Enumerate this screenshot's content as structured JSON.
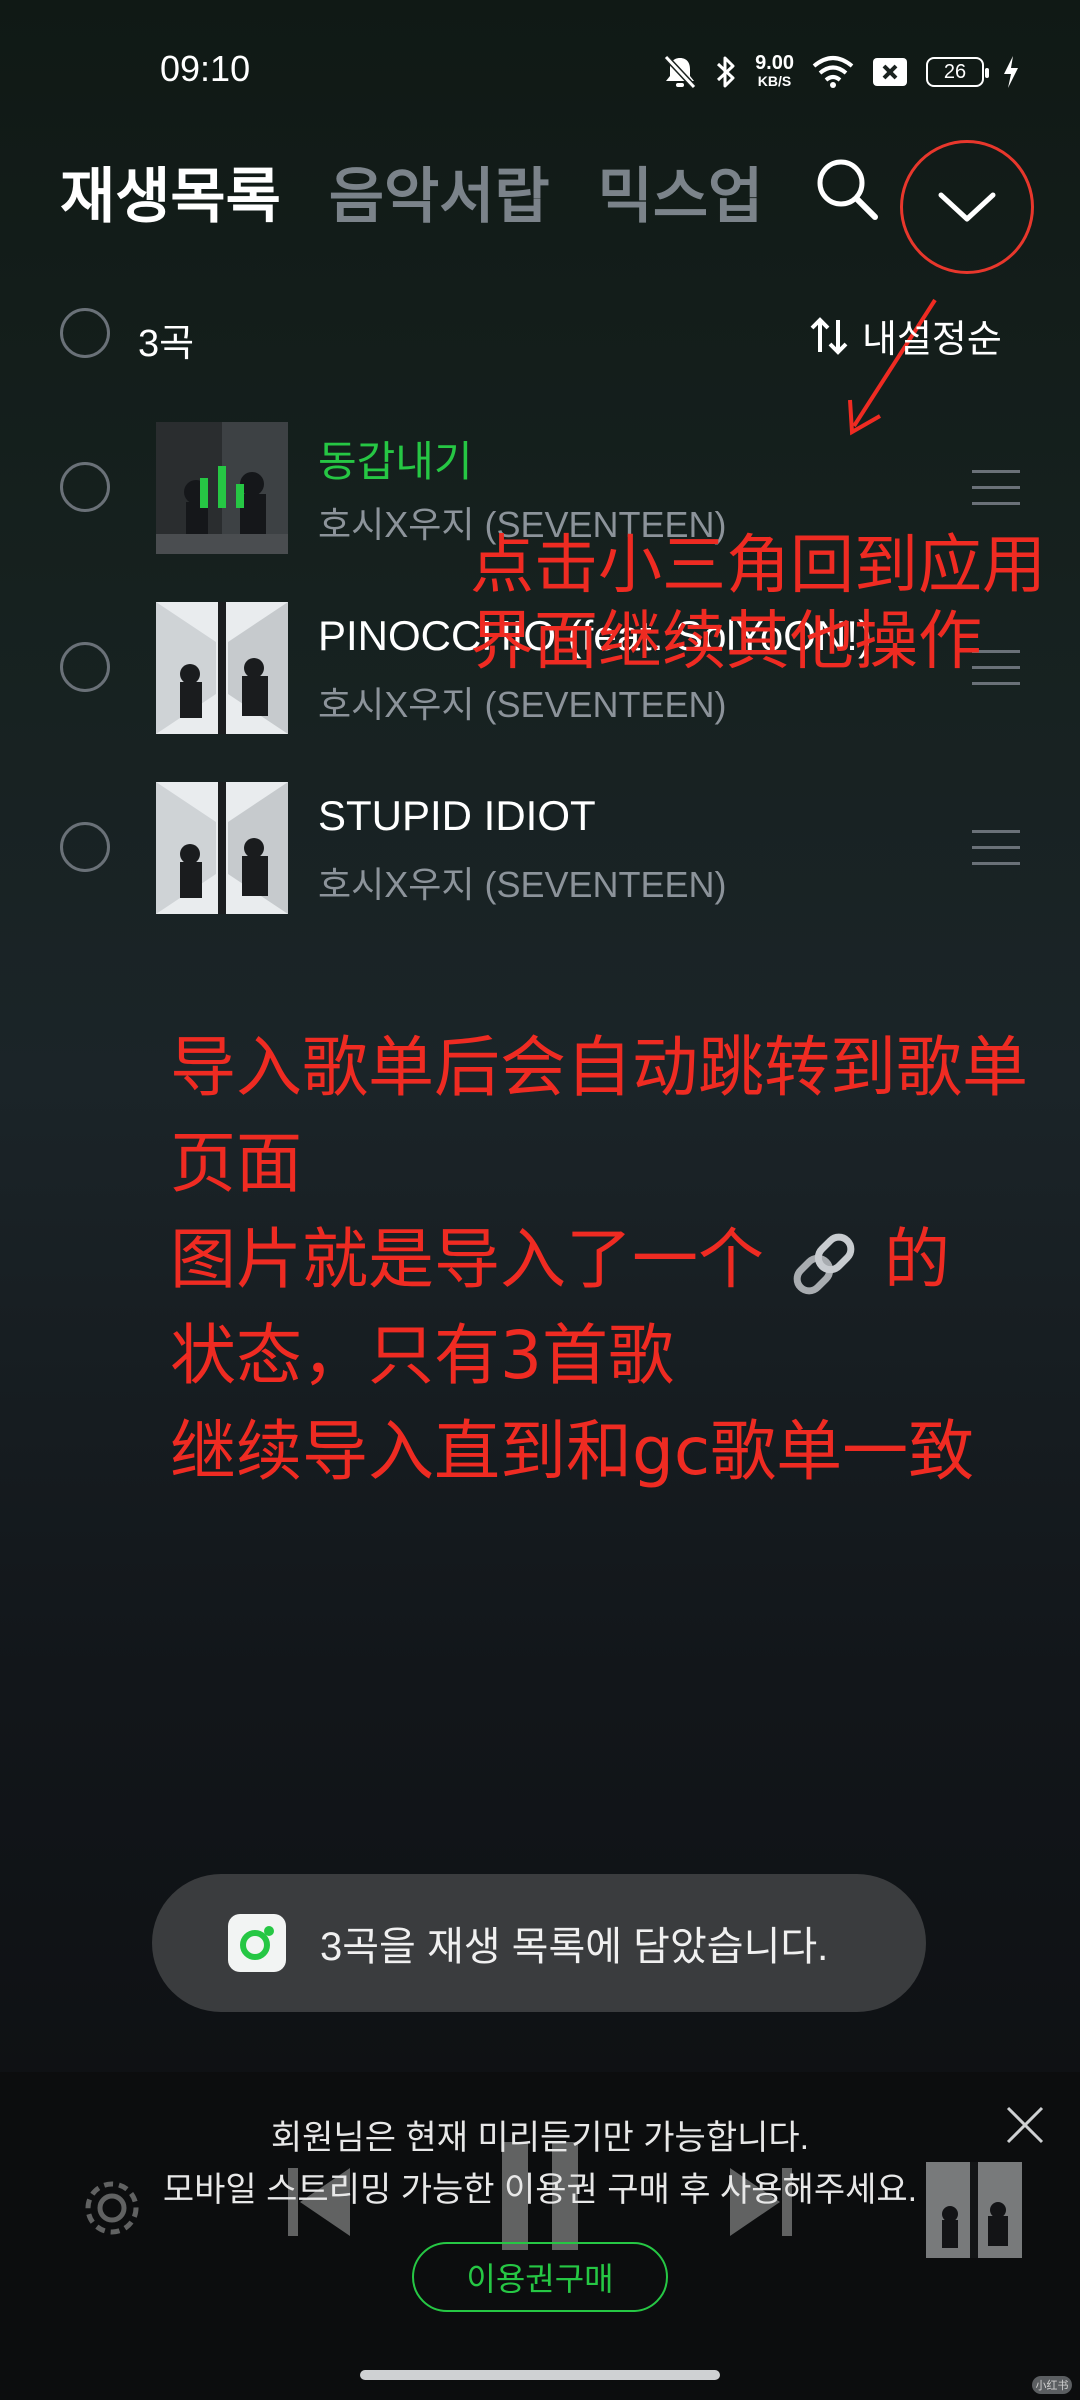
{
  "status_bar": {
    "time": "09:10",
    "net_speed_value": "9.00",
    "net_speed_unit": "KB/S",
    "battery": "26",
    "icons": [
      "mute-icon",
      "bluetooth-icon",
      "wifi-icon",
      "x-box-icon",
      "battery-icon",
      "charging-icon"
    ]
  },
  "header": {
    "tabs": [
      {
        "label": "재생목록",
        "active": true
      },
      {
        "label": "음악서랍",
        "active": false
      },
      {
        "label": "믹스업",
        "active": false
      }
    ]
  },
  "list_header": {
    "count": "3곡",
    "sort_label": "내설정순"
  },
  "songs": [
    {
      "title": "동갑내기",
      "artist": "호시X우지 (SEVENTEEN)",
      "playing": true
    },
    {
      "title": "PINOCCHIO (feat. SolYoON!)",
      "artist": "호시X우지 (SEVENTEEN)",
      "playing": false
    },
    {
      "title": "STUPID IDIOT",
      "artist": "호시X우지 (SEVENTEEN)",
      "playing": false
    }
  ],
  "annotations": {
    "note1": "点击小三角回到应用界面继续其他操作",
    "note2_line1": "导入歌单后会自动跳转到歌单页面",
    "note2_line2a": "图片就是导入了一个",
    "note2_line2b": "的",
    "note2_line3": "状态，只有3首歌",
    "note2_line4": "继续导入直到和gc歌单一致"
  },
  "toast": {
    "text": "3곡을 재생 목록에 담았습니다."
  },
  "player_notice": {
    "line1": "회원님은 현재 미리듣기만 가능합니다.",
    "line2": "모바일 스트리밍 가능한 이용권 구매 후 사용해주세요.",
    "buy_label": "이용권구매"
  },
  "watermark": "小红书",
  "colors": {
    "accent_green": "#26c744",
    "annotation_red": "#ef2b22"
  }
}
